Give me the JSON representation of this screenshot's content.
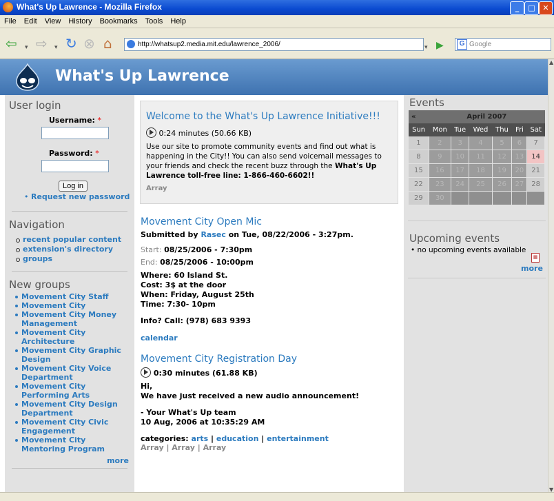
{
  "window": {
    "title": "What's Up Lawrence - Mozilla Firefox"
  },
  "menu": [
    "File",
    "Edit",
    "View",
    "History",
    "Bookmarks",
    "Tools",
    "Help"
  ],
  "browser": {
    "url": "http://whatsup2.media.mit.edu/lawrence_2006/",
    "search_placeholder": "Google"
  },
  "site": {
    "name": "What's Up Lawrence"
  },
  "login": {
    "title": "User login",
    "username_label": "Username:",
    "password_label": "Password:",
    "required": "*",
    "button": "Log in",
    "request_link": "Request new password"
  },
  "navigation": {
    "title": "Navigation",
    "items": [
      "recent popular content",
      "extension's directory",
      "groups"
    ]
  },
  "groups": {
    "title": "New groups",
    "items": [
      "Movement City Staff",
      "Movement City",
      "Movement City Money Management",
      "Movement City Architecture",
      "Movement City Graphic Design",
      "Movement City Voice Department",
      "Movement City Performing Arts",
      "Movement City Design Department",
      "Movement City Civic Engagement",
      "Movement City Mentoring Program"
    ],
    "more": "more"
  },
  "welcome": {
    "title": "Welcome to the What's Up Lawrence Initiative!!!",
    "duration": "0:24 minutes (50.66 KB)",
    "body": "Use our site to promote community events and find out what is happening in the City!! You can also send voicemail messages to your friends and check the recent buzz through the",
    "bold": "What's Up Lawrence toll-free line: 1-866-460-6602!!",
    "footer": "Array"
  },
  "post1": {
    "title": "Movement City Open Mic",
    "submitted_prefix": "Submitted by",
    "author": "Rasec",
    "submitted_suffix": "on Tue, 08/22/2006 - 3:27pm.",
    "start_label": "Start:",
    "start_value": "08/25/2006 - 7:30pm",
    "end_label": "End:",
    "end_value": "08/25/2006 - 10:00pm",
    "details": [
      "Where: 60 Island St.",
      "Cost: 3$ at the door",
      "When: Friday, August 25th",
      "Time: 7:30- 10pm"
    ],
    "info": "Info? Call: (978) 683 9393",
    "calendar_link": "calendar"
  },
  "post2": {
    "title": "Movement City Registration Day",
    "duration": "0:30 minutes (61.88 KB)",
    "lines": [
      "Hi,",
      "We have just received a new audio announcement!"
    ],
    "sign1": "- Your What's Up team",
    "sign2": "10 Aug, 2006 at 10:35:29 AM",
    "categories_label": "categories:",
    "categories": [
      "arts",
      "education",
      "entertainment"
    ],
    "array_line": "Array | Array | Array"
  },
  "events": {
    "title": "Events",
    "prev": "«",
    "month": "April 2007",
    "weekdays": [
      "Sun",
      "Mon",
      "Tue",
      "Wed",
      "Thu",
      "Fri",
      "Sat"
    ],
    "weeks": [
      [
        "1",
        "2",
        "3",
        "4",
        "5",
        "6",
        "7"
      ],
      [
        "8",
        "9",
        "10",
        "11",
        "12",
        "13",
        "14"
      ],
      [
        "15",
        "16",
        "17",
        "18",
        "19",
        "20",
        "21"
      ],
      [
        "22",
        "23",
        "24",
        "25",
        "26",
        "27",
        "28"
      ],
      [
        "29",
        "30",
        "",
        "",
        "",
        "",
        ""
      ]
    ],
    "today": "14"
  },
  "upcoming": {
    "title": "Upcoming events",
    "empty": "no upcoming events available",
    "more": "more"
  },
  "colors": {
    "link": "#2c7bbf",
    "header": "#4d82bf",
    "sidebar": "#e2e2e2",
    "today": "#f2c4c4"
  }
}
